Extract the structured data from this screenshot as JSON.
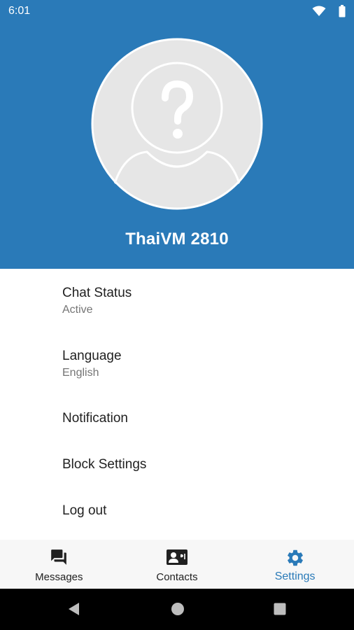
{
  "status_bar": {
    "time": "6:01"
  },
  "profile": {
    "name": "ThaiVM 2810"
  },
  "settings": {
    "chat_status": {
      "label": "Chat Status",
      "value": "Active"
    },
    "language": {
      "label": "Language",
      "value": "English"
    },
    "notification": {
      "label": "Notification"
    },
    "block_settings": {
      "label": "Block Settings"
    },
    "log_out": {
      "label": "Log out"
    }
  },
  "bottom_nav": {
    "tabs": [
      {
        "label": "Messages",
        "icon": "messages-icon",
        "active": false
      },
      {
        "label": "Contacts",
        "icon": "contacts-icon",
        "active": false
      },
      {
        "label": "Settings",
        "icon": "gear-icon",
        "active": true
      }
    ]
  },
  "colors": {
    "primary": "#2a7ab8",
    "nav_background": "#f7f7f7",
    "text_primary": "#212121",
    "text_secondary": "#757575"
  }
}
